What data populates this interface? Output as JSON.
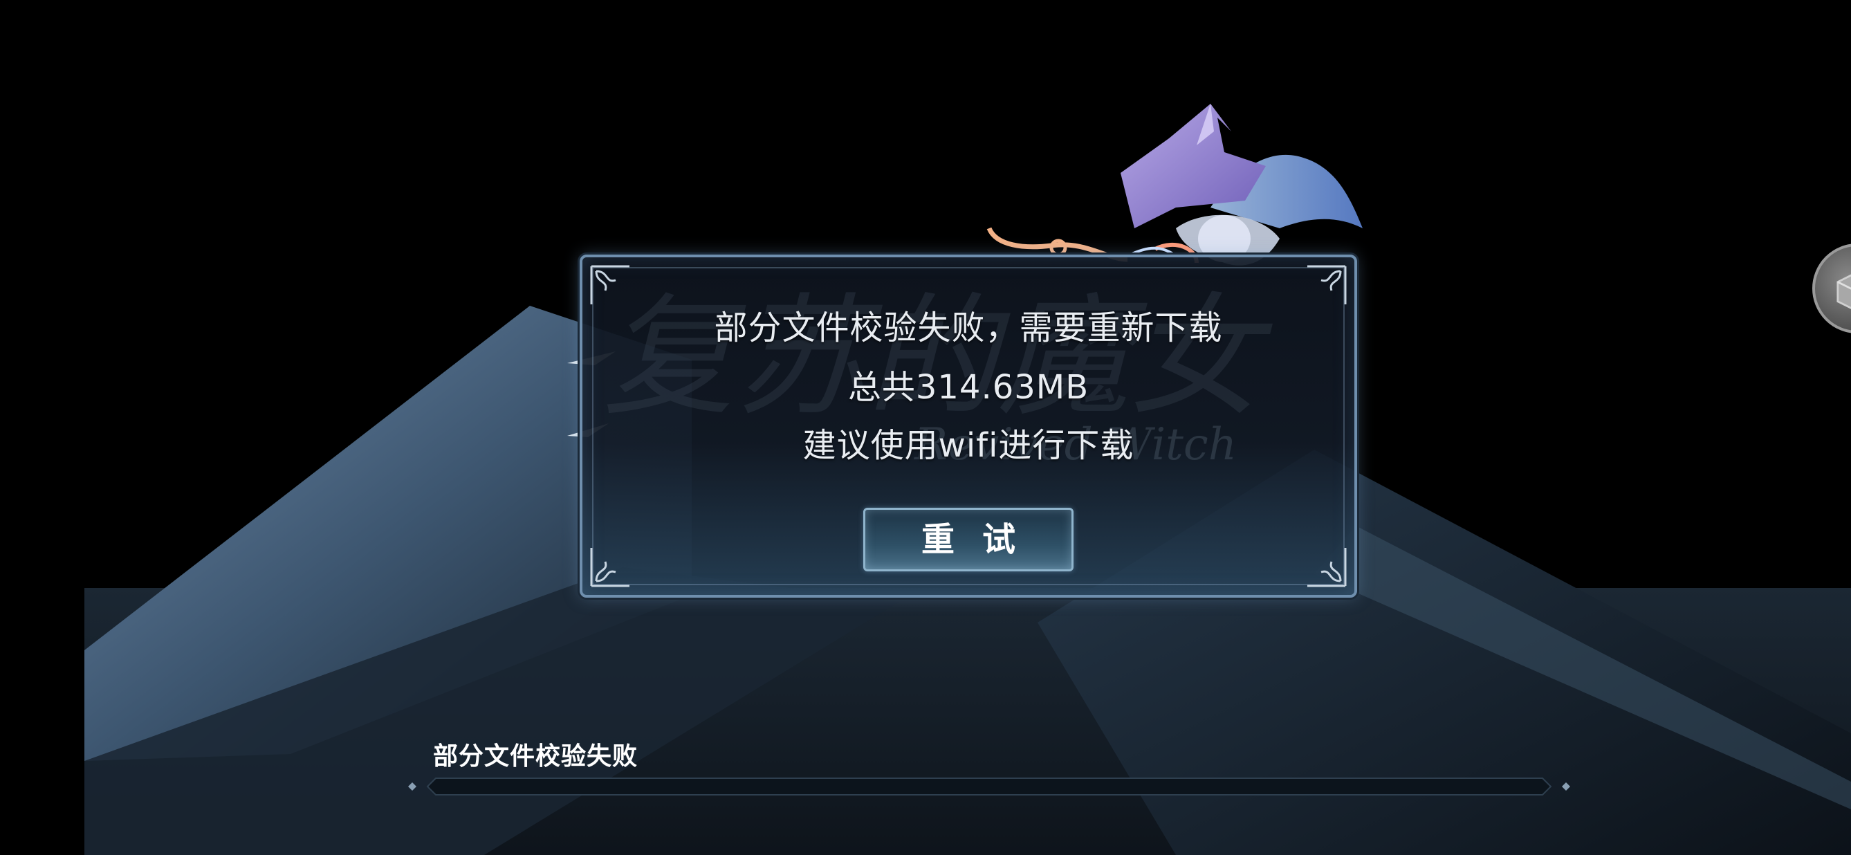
{
  "dialog": {
    "line1": "部分文件校验失败，需要重新下载",
    "line2": "总共314.63MB",
    "line3": "建议使用wifi进行下载",
    "retry_label": "重试",
    "logo_title": "复苏的魔女",
    "logo_subtitle": "Revived Witch"
  },
  "status": {
    "message": "部分文件校验失败",
    "progress": 0
  },
  "icons": {
    "side_button": "cube-icon",
    "character": "witch-character-art"
  },
  "colors": {
    "dialog_border": "#6f8fae",
    "button_border": "#8fb4cc",
    "text": "#e9edf2"
  }
}
